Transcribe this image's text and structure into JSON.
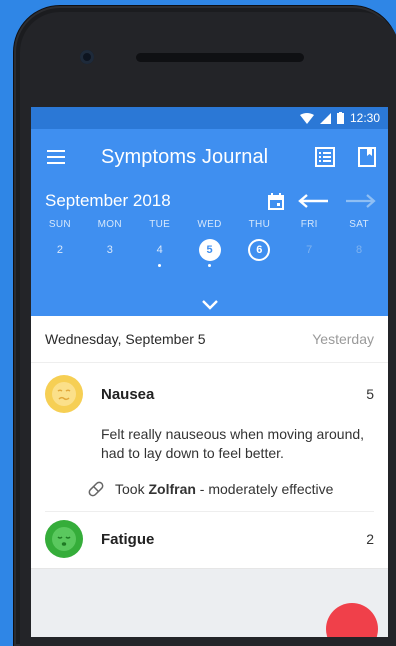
{
  "status": {
    "time": "12:30"
  },
  "toolbar": {
    "title": "Symptoms Journal"
  },
  "calendar": {
    "month": "September 2018",
    "days": [
      {
        "name": "SUN",
        "num": "2",
        "state": "normal",
        "has_entry": false
      },
      {
        "name": "MON",
        "num": "3",
        "state": "normal",
        "has_entry": false
      },
      {
        "name": "TUE",
        "num": "4",
        "state": "normal",
        "has_entry": true
      },
      {
        "name": "WED",
        "num": "5",
        "state": "selected",
        "has_entry": true
      },
      {
        "name": "THU",
        "num": "6",
        "state": "today",
        "has_entry": false
      },
      {
        "name": "FRI",
        "num": "7",
        "state": "future",
        "has_entry": false
      },
      {
        "name": "SAT",
        "num": "8",
        "state": "future",
        "has_entry": false
      }
    ]
  },
  "day_header": {
    "date": "Wednesday, September 5",
    "relative": "Yesterday"
  },
  "entries": [
    {
      "name": "Nausea",
      "severity": "5",
      "note": "Felt really nauseous when moving around, had to lay down to feel better.",
      "med_prefix": "Took ",
      "med_name": "Zolfran",
      "med_suffix": " - moderately effective",
      "color": "#f6cf54"
    },
    {
      "name": "Fatigue",
      "severity": "2",
      "color": "#35ad3a"
    }
  ],
  "colors": {
    "primary": "#3f8ff0",
    "status": "#2b78d6",
    "fab": "#f0404a",
    "background": "#2f86e6"
  }
}
